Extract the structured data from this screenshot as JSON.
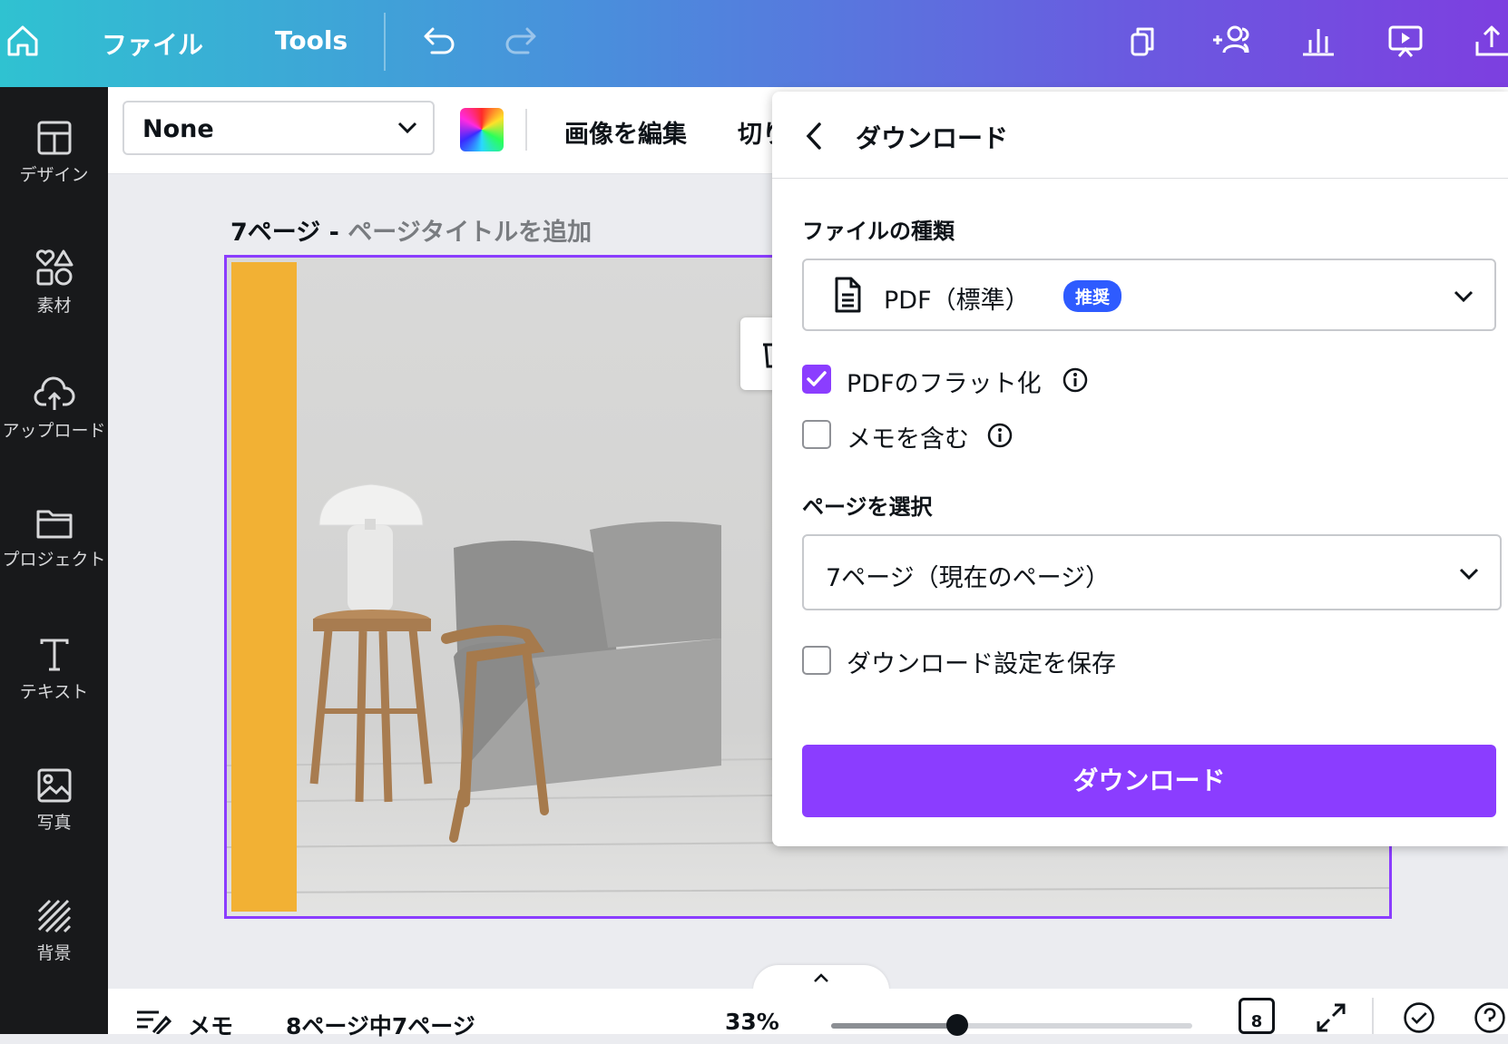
{
  "topbar": {
    "file_label": "ファイル",
    "tools_label": "Tools"
  },
  "sidebar": {
    "items": [
      {
        "label": "デザイン",
        "icon": "layout-icon"
      },
      {
        "label": "素材",
        "icon": "elements-icon"
      },
      {
        "label": "アップロード",
        "icon": "cloud-upload-icon"
      },
      {
        "label": "プロジェクト",
        "icon": "folder-icon"
      },
      {
        "label": "テキスト",
        "icon": "text-icon"
      },
      {
        "label": "写真",
        "icon": "photo-icon"
      },
      {
        "label": "背景",
        "icon": "background-icon"
      }
    ]
  },
  "toolbar": {
    "font_value": "None",
    "edit_image_label": "画像を編集",
    "crop_label": "切り"
  },
  "canvas": {
    "page_label": "7ページ - ",
    "page_title_placeholder": "ページタイトルを追加",
    "accent_color": "#f2b134"
  },
  "download_panel": {
    "title": "ダウンロード",
    "file_type_label": "ファイルの種類",
    "file_type_value": "PDF（標準）",
    "recommended_badge": "推奨",
    "flatten_pdf_label": "PDFのフラット化",
    "flatten_pdf_checked": true,
    "include_notes_label": "メモを含む",
    "include_notes_checked": false,
    "select_pages_label": "ページを選択",
    "pages_value": "7ページ（現在のページ）",
    "save_settings_label": "ダウンロード設定を保存",
    "save_settings_checked": false,
    "download_button": "ダウンロード"
  },
  "bottombar": {
    "notes_label": "メモ",
    "page_counter": "8ページ中7ページ",
    "zoom": "33%",
    "zoom_fraction": 0.35,
    "page_count_badge": "8"
  },
  "colors": {
    "brand_purple": "#8b3dff",
    "badge_blue": "#2e5bff",
    "sidebar_bg": "#18191b"
  }
}
